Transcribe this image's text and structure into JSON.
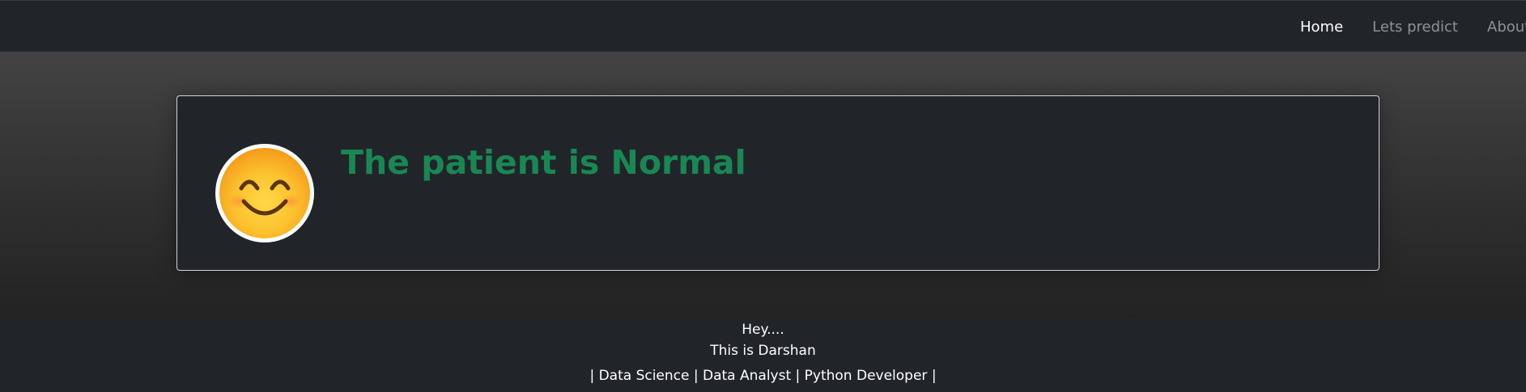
{
  "navbar": {
    "links": [
      {
        "label": "Home",
        "active": true
      },
      {
        "label": "Lets predict",
        "active": false
      },
      {
        "label": "About m",
        "active": false
      }
    ]
  },
  "result": {
    "icon": "smiling-face-emoji-icon",
    "title": "The patient is Normal",
    "title_color": "#198754"
  },
  "footer": {
    "greeting": "Hey....",
    "intro": "This is Darshan",
    "roles": "| Data Science | Data Analyst | Python Developer |"
  }
}
